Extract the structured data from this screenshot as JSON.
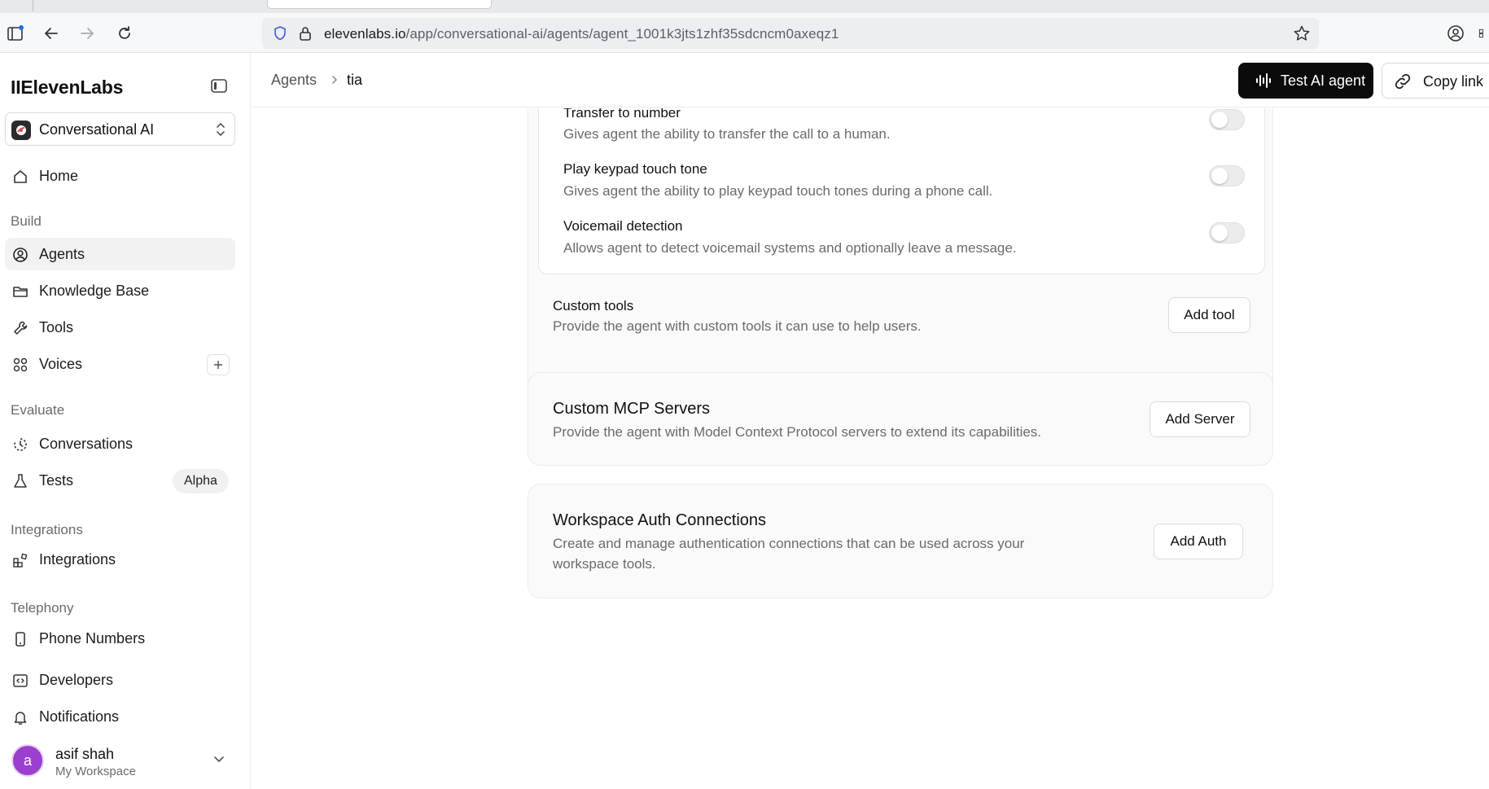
{
  "browser": {
    "url_host": "elevenlabs.io",
    "url_path": "/app/conversational-ai/agents/agent_1001k3jts1zhf35sdcncm0axeqz1"
  },
  "sidebar": {
    "brand": "IIElevenLabs",
    "workspace_selector": "Conversational AI",
    "home": "Home",
    "sections": {
      "build": "Build",
      "evaluate": "Evaluate",
      "integrations": "Integrations",
      "telephony": "Telephony"
    },
    "items": {
      "agents": "Agents",
      "knowledge_base": "Knowledge Base",
      "tools": "Tools",
      "voices": "Voices",
      "conversations": "Conversations",
      "tests": "Tests",
      "tests_badge": "Alpha",
      "integrations": "Integrations",
      "phone_numbers": "Phone Numbers",
      "developers": "Developers",
      "notifications": "Notifications"
    },
    "user": {
      "avatar_letter": "a",
      "name": "asif shah",
      "workspace": "My Workspace"
    }
  },
  "header": {
    "breadcrumb_root": "Agents",
    "breadcrumb_current": "tia",
    "test_button": "Test AI agent",
    "copy_button": "Copy link"
  },
  "tools": {
    "system_tools": [
      {
        "title": "Transfer to number",
        "desc": "Gives agent the ability to transfer the call to a human.",
        "enabled": false
      },
      {
        "title": "Play keypad touch tone",
        "desc": "Gives agent the ability to play keypad touch tones during a phone call.",
        "enabled": false
      },
      {
        "title": "Voicemail detection",
        "desc": "Allows agent to detect voicemail systems and optionally leave a message.",
        "enabled": false
      }
    ],
    "custom_tools": {
      "title": "Custom tools",
      "desc": "Provide the agent with custom tools it can use to help users.",
      "button": "Add tool"
    }
  },
  "mcp": {
    "title": "Custom MCP Servers",
    "desc": "Provide the agent with Model Context Protocol servers to extend its capabilities.",
    "button": "Add Server"
  },
  "auth": {
    "title": "Workspace Auth Connections",
    "desc_line1": "Create and manage authentication connections that can be used across your",
    "desc_line2": "workspace tools.",
    "button": "Add Auth"
  },
  "colors": {
    "primary_button": "#0b0b0b",
    "avatar": "#9b3fce",
    "muted_text": "#6b6b6b"
  }
}
